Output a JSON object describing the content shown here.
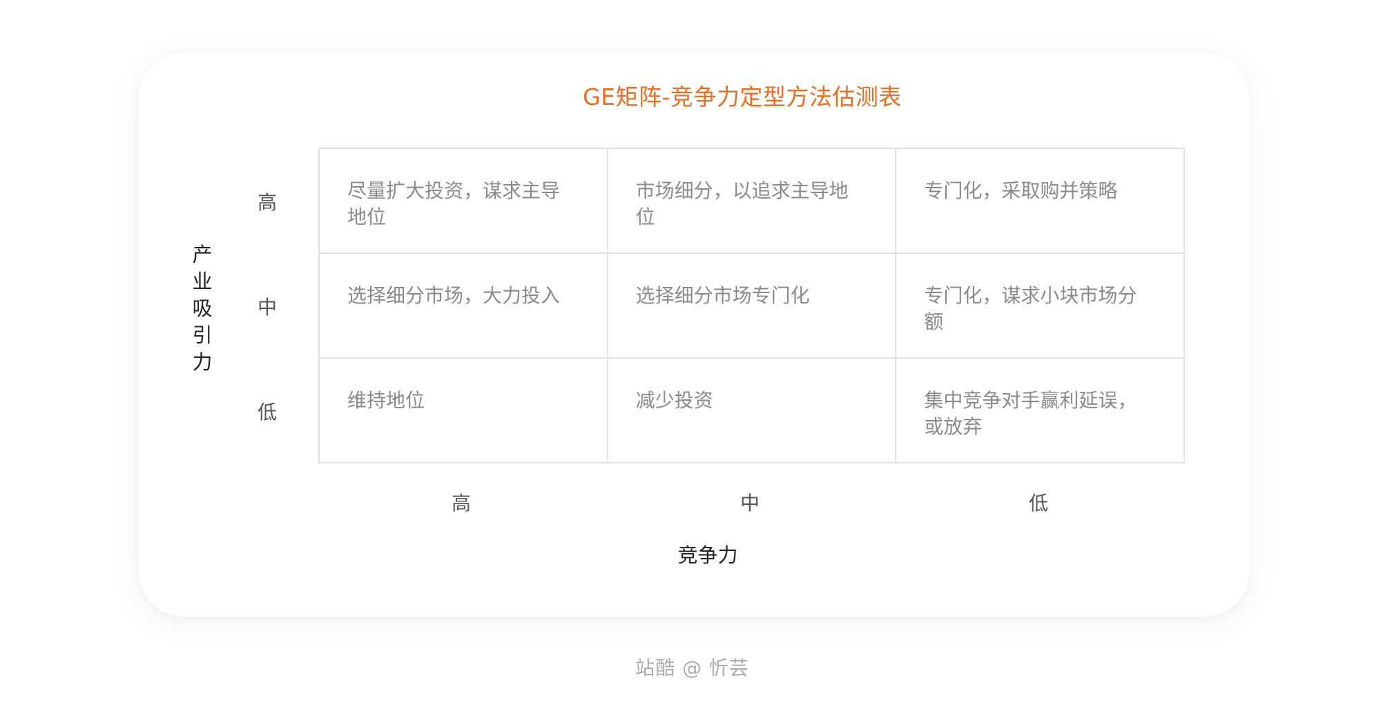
{
  "title": "GE矩阵-竞争力定型方法估测表",
  "y_axis": {
    "title": "产业吸引力",
    "labels": [
      "高",
      "中",
      "低"
    ]
  },
  "x_axis": {
    "title": "竞争力",
    "labels": [
      "高",
      "中",
      "低"
    ]
  },
  "cells": [
    [
      "尽量扩大投资，谋求主导地位",
      "市场细分，以追求主导地位",
      "专门化，采取购并策略"
    ],
    [
      "选择细分市场，大力投入",
      "选择细分市场专门化",
      "专门化，谋求小块市场分额"
    ],
    [
      "维持地位",
      "减少投资",
      "集中竞争对手赢利延误，或放弃"
    ]
  ],
  "watermark": "站酷 @ 忻芸",
  "colors": {
    "title": "#f26a1b",
    "grid_border": "#e2e2e2",
    "cell_text": "#8a8a8a"
  }
}
